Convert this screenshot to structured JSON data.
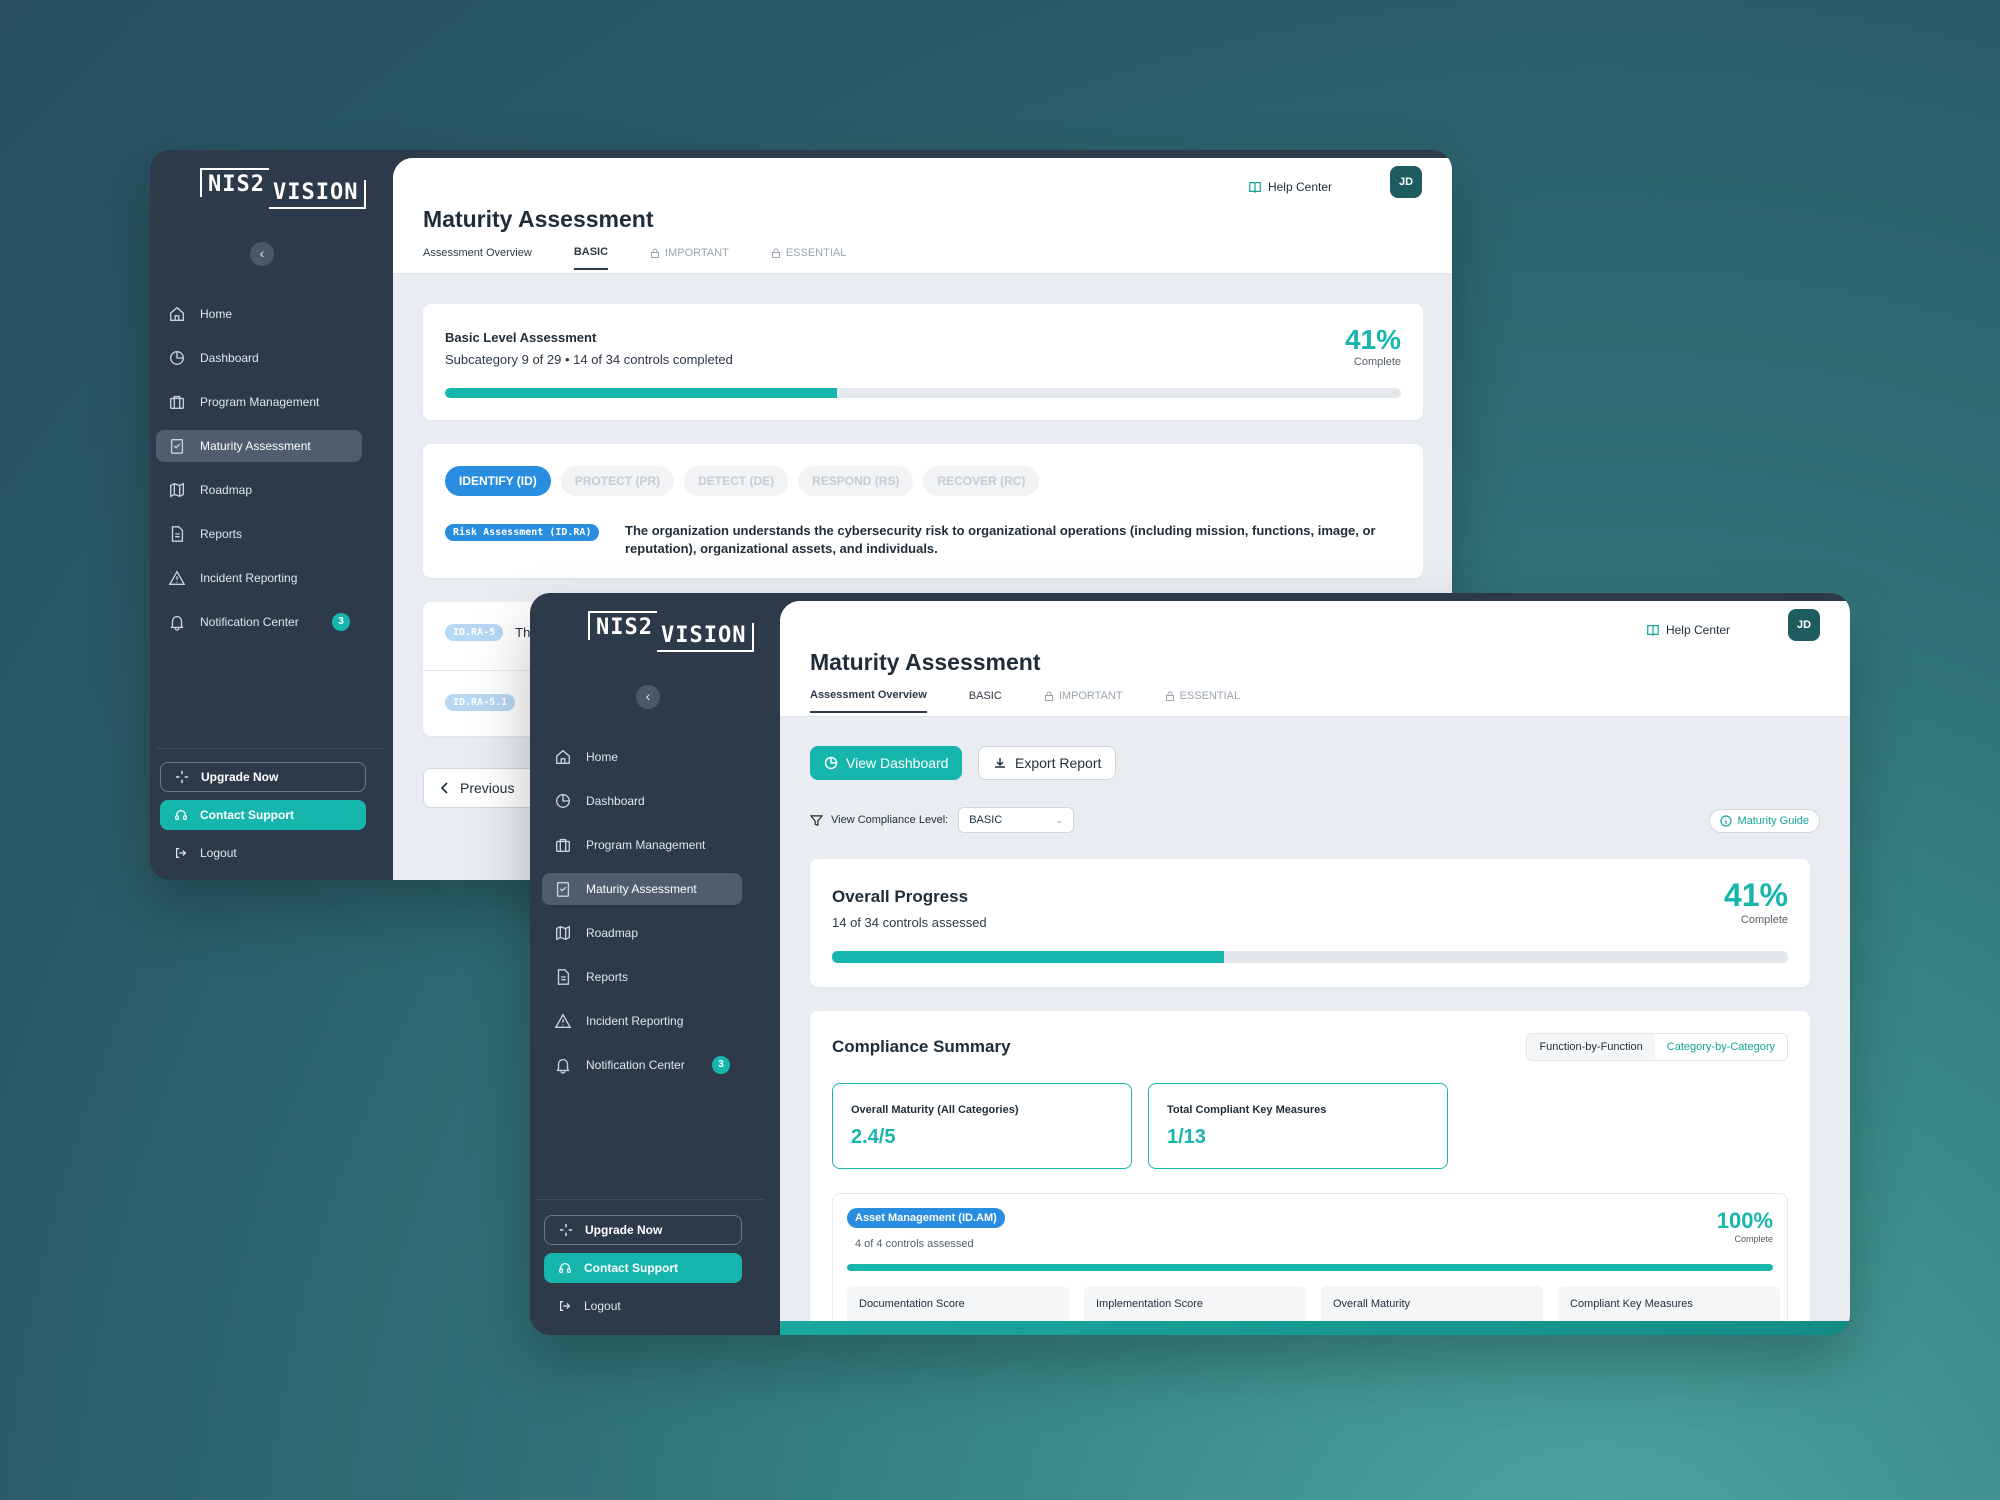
{
  "brand": {
    "logo_left": "NIS2",
    "logo_right": "VISION"
  },
  "nav": [
    {
      "label": "Home"
    },
    {
      "label": "Dashboard"
    },
    {
      "label": "Program Management"
    },
    {
      "label": "Maturity Assessment"
    },
    {
      "label": "Roadmap"
    },
    {
      "label": "Reports"
    },
    {
      "label": "Incident Reporting"
    },
    {
      "label": "Notification Center",
      "badge": "3"
    }
  ],
  "sidebar_bottom": {
    "upgrade": "Upgrade Now",
    "support": "Contact Support",
    "logout": "Logout"
  },
  "header": {
    "help": "Help Center",
    "avatar": "JD",
    "title": "Maturity Assessment",
    "tabs": [
      "Assessment Overview",
      "BASIC",
      "IMPORTANT",
      "ESSENTIAL"
    ]
  },
  "back": {
    "level_card": {
      "title": "Basic Level Assessment",
      "subtitle": "Subcategory 9 of 29 • 14 of 34 controls completed",
      "percent": "41%",
      "percent_label": "Complete",
      "progress": 0.41
    },
    "functions": [
      "IDENTIFY (ID)",
      "PROTECT (PR)",
      "DETECT (DE)",
      "RESPOND (RS)",
      "RECOVER (RC)"
    ],
    "category_tag": "Risk Assessment (ID.RA)",
    "category_desc": "The organization understands the cybersecurity risk to organizational operations (including mission, functions, image, or reputation), organizational assets, and individuals.",
    "rows": [
      {
        "tag": "ID.RA-5",
        "text": "Th"
      },
      {
        "tag": "ID.RA-5.1",
        "text": ""
      }
    ],
    "prev_button": "Previous"
  },
  "front": {
    "view_dashboard": "View Dashboard",
    "export_report": "Export Report",
    "filter_label": "View Compliance Level:",
    "filter_value": "BASIC",
    "maturity_guide": "Maturity Guide",
    "overall": {
      "title": "Overall Progress",
      "subtitle": "14 of 34 controls assessed",
      "percent": "41%",
      "percent_label": "Complete",
      "progress": 0.41
    },
    "summary": {
      "title": "Compliance Summary",
      "toggle": [
        "Function-by-Function",
        "Category-by-Category"
      ],
      "stat1_label": "Overall Maturity (All Categories)",
      "stat1_value": "2.4/5",
      "stat2_label": "Total Compliant Key Measures",
      "stat2_value": "1/13",
      "category": {
        "tag": "Asset Management (ID.AM)",
        "subtitle": "4 of 4 controls assessed",
        "percent": "100%",
        "percent_label": "Complete",
        "progress": 1.0,
        "metrics": [
          "Documentation Score",
          "Implementation Score",
          "Overall Maturity",
          "Compliant Key Measures"
        ]
      }
    }
  },
  "colors": {
    "accent": "#16b6ad",
    "sidebar": "#2c3a4a",
    "blue": "#2a8ee0"
  }
}
